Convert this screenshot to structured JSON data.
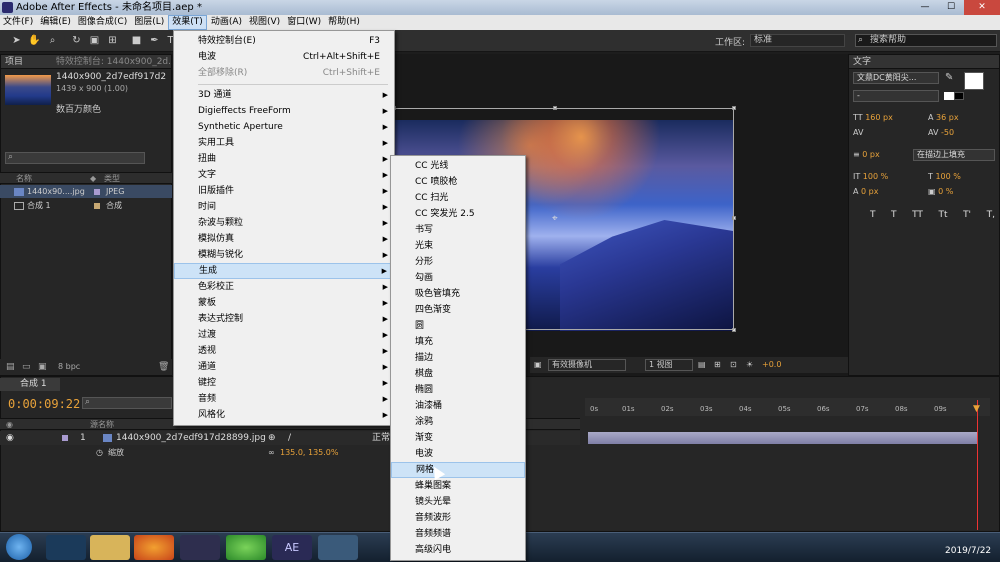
{
  "window": {
    "title": "Adobe After Effects - 未命名项目.aep *"
  },
  "menubar": [
    "文件(F)",
    "编辑(E)",
    "图像合成(C)",
    "图层(L)",
    "效果(T)",
    "动画(A)",
    "视图(V)",
    "窗口(W)",
    "帮助(H)"
  ],
  "toolbar": {
    "workspace_label": "工作区:",
    "workspace_value": "标准",
    "search_placeholder": "搜索帮助"
  },
  "project": {
    "tab_project": "项目",
    "tab_effects": "特效控制台: 1440x900_2d...",
    "file_name": "1440x900_2d7edf917d2",
    "file_dims": "1439 x 900 (1.00)",
    "color_depth": "数百万颜色",
    "col_name": "名称",
    "col_type": "类型",
    "items": [
      {
        "name": "1440x90....jpg",
        "type": "JPEG"
      },
      {
        "name": "合成 1",
        "type": "合成"
      }
    ],
    "bpc": "8 bpc"
  },
  "comp_footer": {
    "camera": "有效摄像机",
    "views": "1 视图",
    "offset": "+0.0"
  },
  "text_panel": {
    "title": "文字",
    "font_name": "文鼎DC黄阳尖...",
    "font_style": "-",
    "size": "160 px",
    "leading": "36 px",
    "kerning": "-50",
    "stroke_width": "0 px",
    "stroke_mode": "在描边上填充",
    "vscale": "100 %",
    "hscale": "100 %",
    "baseline": "0 px",
    "tsume": "0 %",
    "style_buttons": [
      "T",
      "T",
      "TT",
      "Tt",
      "T'",
      "T,"
    ]
  },
  "timeline": {
    "tab": "合成 1",
    "timecode": "0:00:09:22",
    "col_layer": "源名称",
    "layer_num": "1",
    "layer_name": "1440x900_2d7edf917d28899.jpg",
    "mode": "正常",
    "prop_name": "缩放",
    "prop_value": "135.0, 135.0%",
    "ticks": [
      "0s",
      "01s",
      "02s",
      "03s",
      "04s",
      "05s",
      "06s",
      "07s",
      "08s",
      "09s"
    ]
  },
  "effects_menu": [
    {
      "label": "特效控制台(E)",
      "shortcut": "F3"
    },
    {
      "label": "电波",
      "shortcut": "Ctrl+Alt+Shift+E"
    },
    {
      "label": "全部移除(R)",
      "shortcut": "Ctrl+Shift+E",
      "disabled": true
    },
    {
      "label": "3D 通道",
      "sub": true
    },
    {
      "label": "Digieffects FreeForm",
      "sub": true
    },
    {
      "label": "Synthetic Aperture",
      "sub": true
    },
    {
      "label": "实用工具",
      "sub": true
    },
    {
      "label": "扭曲",
      "sub": true
    },
    {
      "label": "文字",
      "sub": true
    },
    {
      "label": "旧版插件",
      "sub": true
    },
    {
      "label": "时间",
      "sub": true
    },
    {
      "label": "杂波与颗粒",
      "sub": true
    },
    {
      "label": "模拟仿真",
      "sub": true
    },
    {
      "label": "模糊与锐化",
      "sub": true
    },
    {
      "label": "生成",
      "sub": true,
      "highlight": true
    },
    {
      "label": "色彩校正",
      "sub": true
    },
    {
      "label": "蒙板",
      "sub": true
    },
    {
      "label": "表达式控制",
      "sub": true
    },
    {
      "label": "过渡",
      "sub": true
    },
    {
      "label": "透视",
      "sub": true
    },
    {
      "label": "通道",
      "sub": true
    },
    {
      "label": "键控",
      "sub": true
    },
    {
      "label": "音频",
      "sub": true
    },
    {
      "label": "风格化",
      "sub": true
    }
  ],
  "generate_submenu": [
    {
      "label": "CC 光线"
    },
    {
      "label": "CC 喷胶枪"
    },
    {
      "label": "CC 扫光"
    },
    {
      "label": "CC 突发光 2.5"
    },
    {
      "label": "书写"
    },
    {
      "label": "光束"
    },
    {
      "label": "分形"
    },
    {
      "label": "勾画"
    },
    {
      "label": "吸色管填充"
    },
    {
      "label": "四色渐变"
    },
    {
      "label": "圆"
    },
    {
      "label": "填充"
    },
    {
      "label": "描边"
    },
    {
      "label": "棋盘"
    },
    {
      "label": "椭圆"
    },
    {
      "label": "油漆桶"
    },
    {
      "label": "涂鸦"
    },
    {
      "label": "渐变"
    },
    {
      "label": "电波"
    },
    {
      "label": "网格",
      "highlight": true
    },
    {
      "label": "蜂巢图案"
    },
    {
      "label": "镜头光晕"
    },
    {
      "label": "音频波形"
    },
    {
      "label": "音频频谱"
    },
    {
      "label": "高级闪电"
    }
  ],
  "taskbar": {
    "date": "2019/7/22",
    "ae_label": "AE"
  }
}
